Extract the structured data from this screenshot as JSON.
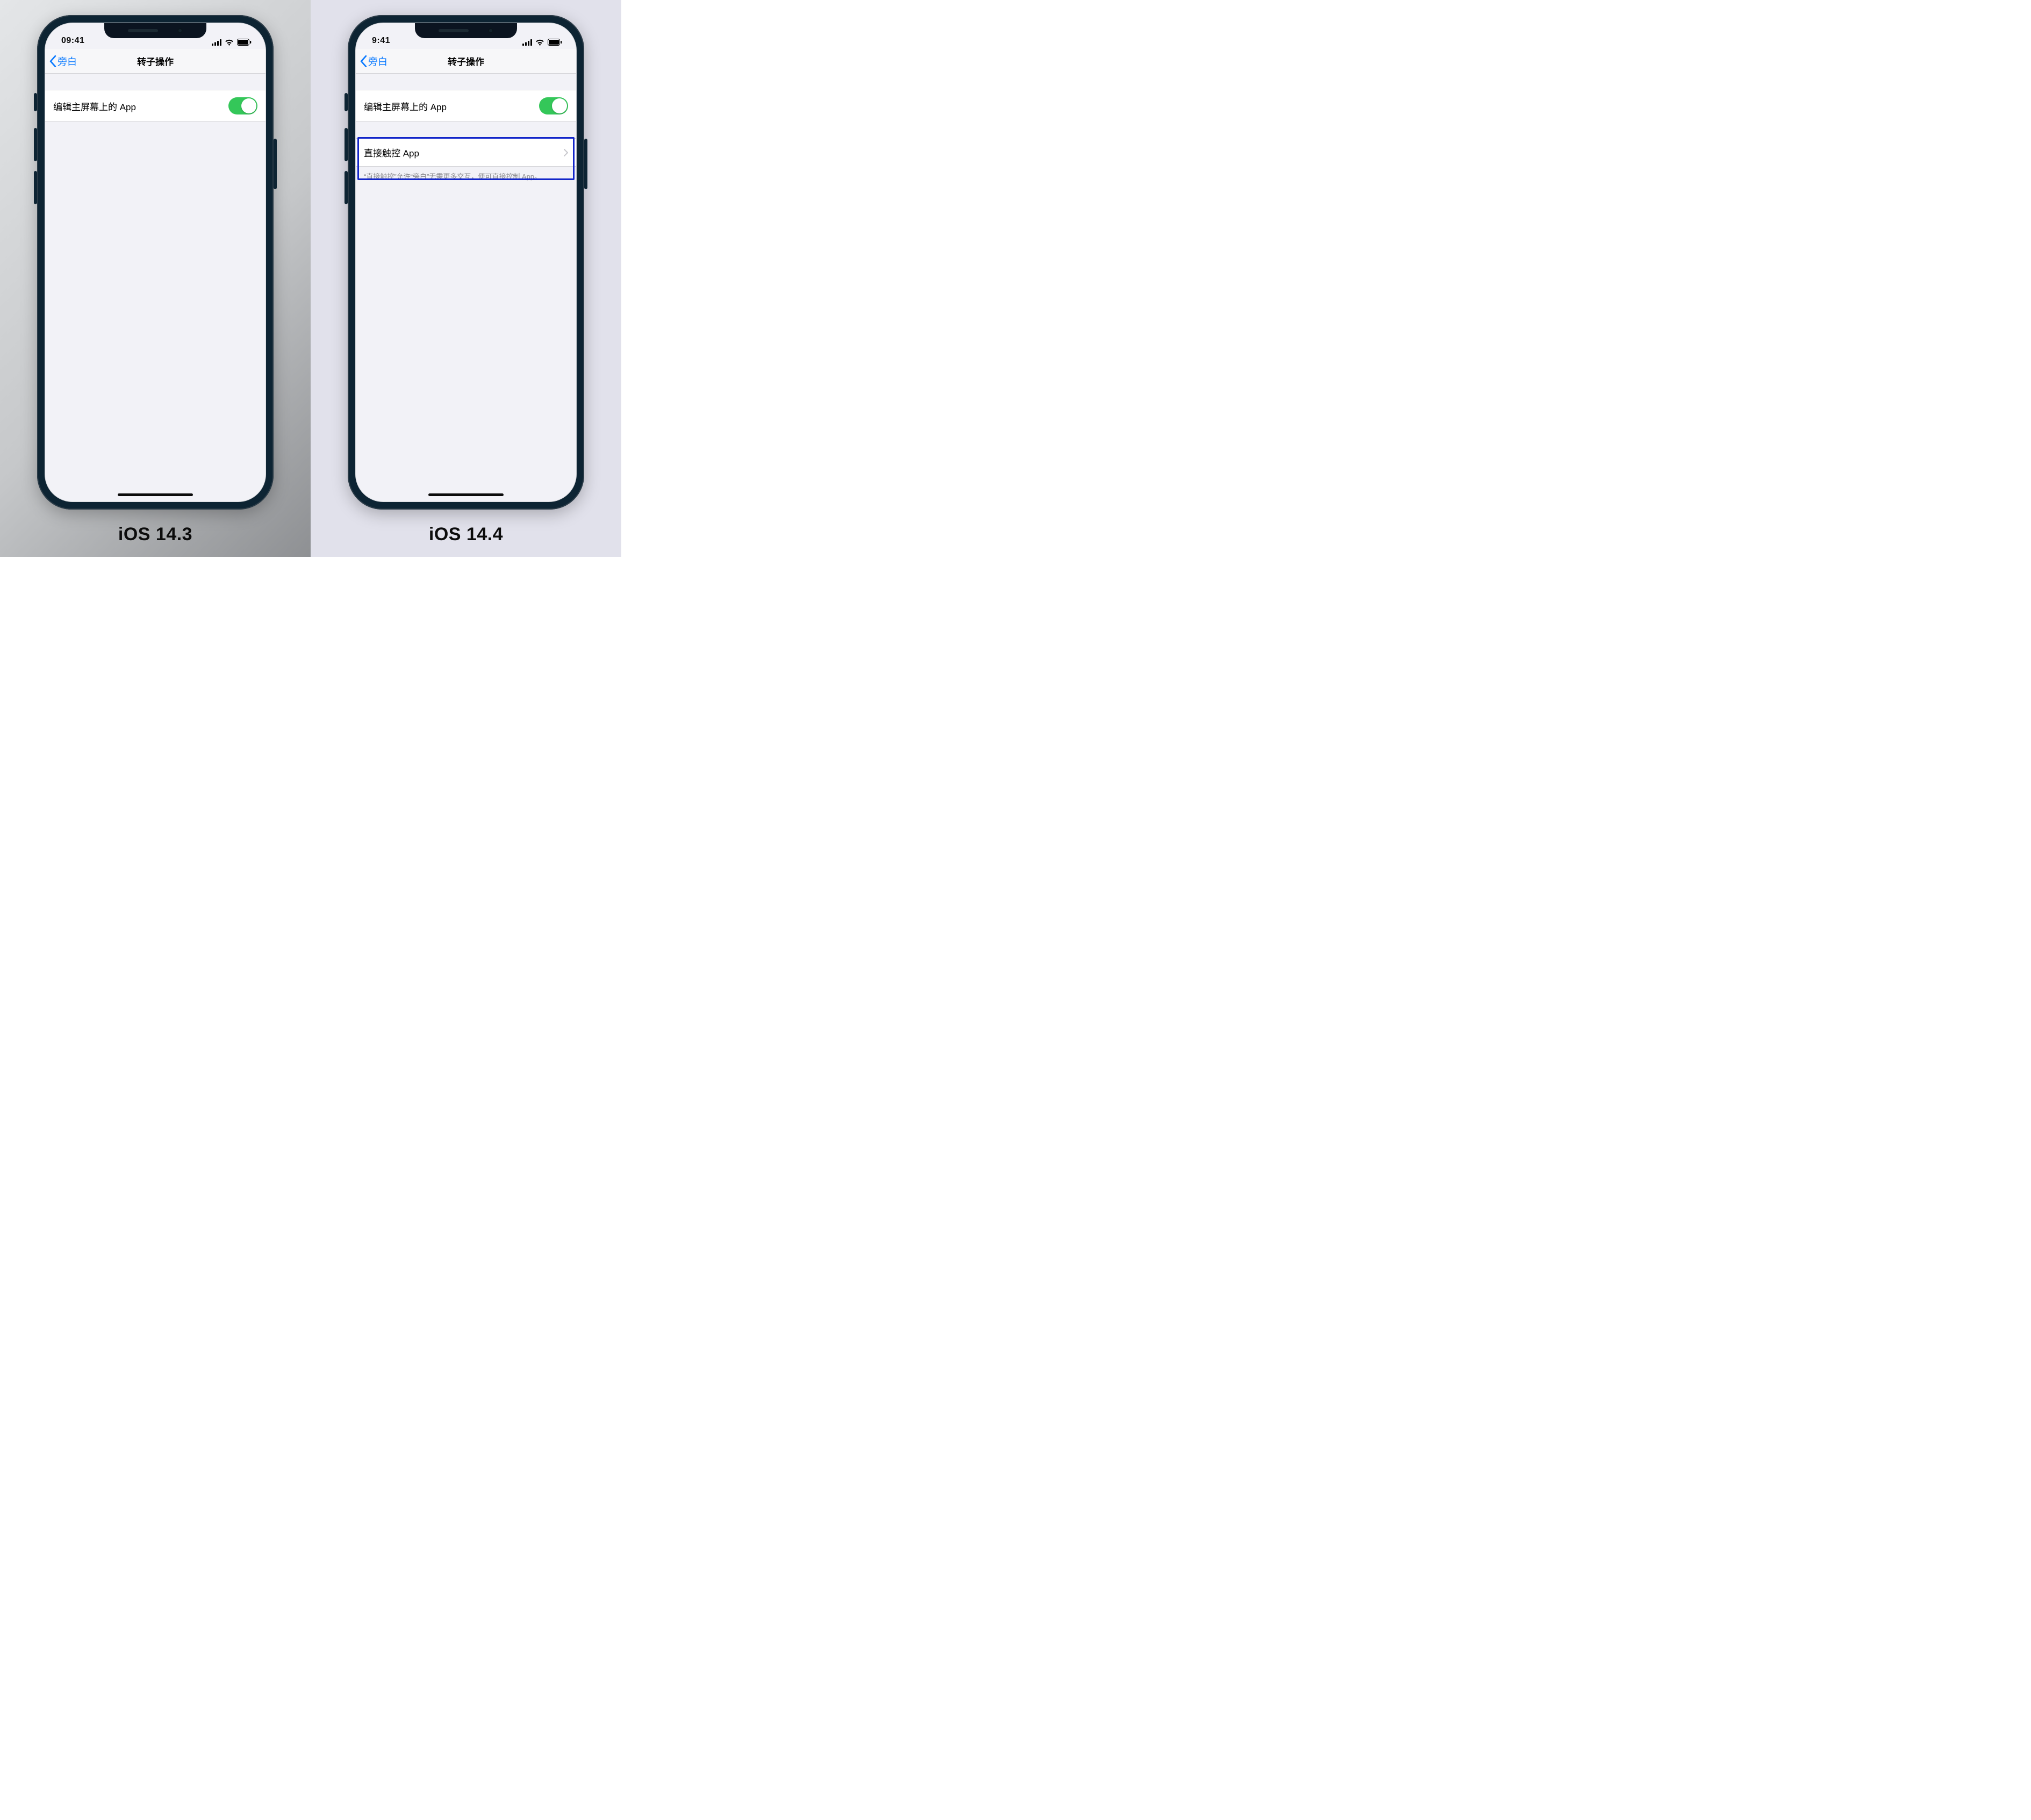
{
  "left": {
    "caption": "iOS 14.3",
    "status": {
      "time": "09:41"
    },
    "nav": {
      "back_label": "旁白",
      "title": "转子操作"
    },
    "cells": {
      "edit_home": {
        "label": "编辑主屏幕上的 App",
        "on": true
      }
    }
  },
  "right": {
    "caption": "iOS 14.4",
    "status": {
      "time": "9:41"
    },
    "nav": {
      "back_label": "旁白",
      "title": "转子操作"
    },
    "cells": {
      "edit_home": {
        "label": "编辑主屏幕上的 App",
        "on": true
      },
      "direct_touch": {
        "label": "直接触控 App"
      },
      "direct_touch_footer": "“直接触控”允许“旁白”无需更多交互，便可直接控制 App。"
    }
  }
}
